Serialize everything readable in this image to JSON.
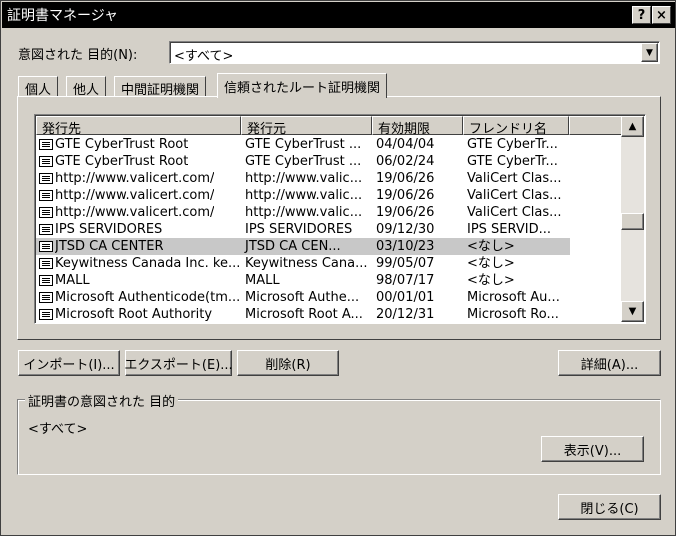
{
  "window": {
    "title": "証明書マネージャ",
    "help_btn": "?",
    "close_btn": "×"
  },
  "purpose": {
    "label": "意図された 目的(N):",
    "value": "<すべて>"
  },
  "tabs": [
    {
      "label": "個人",
      "active": false
    },
    {
      "label": "他人",
      "active": false
    },
    {
      "label": "中間証明機関",
      "active": false
    },
    {
      "label": "信頼されたルート証明機関",
      "active": true
    }
  ],
  "table": {
    "columns": [
      "発行先",
      "発行元",
      "有効期限",
      "フレンドリ名"
    ],
    "rows": [
      {
        "issued_to": "GTE CyberTrust Root",
        "issued_by": "GTE CyberTrust ...",
        "expires": "04/04/04",
        "friendly": "GTE CyberTr..."
      },
      {
        "issued_to": "GTE CyberTrust Root",
        "issued_by": "GTE CyberTrust ...",
        "expires": "06/02/24",
        "friendly": "GTE CyberTr..."
      },
      {
        "issued_to": "http://www.valicert.com/",
        "issued_by": "http://www.valic...",
        "expires": "19/06/26",
        "friendly": "ValiCert Clas..."
      },
      {
        "issued_to": "http://www.valicert.com/",
        "issued_by": "http://www.valic...",
        "expires": "19/06/26",
        "friendly": "ValiCert Clas..."
      },
      {
        "issued_to": "http://www.valicert.com/",
        "issued_by": "http://www.valic...",
        "expires": "19/06/26",
        "friendly": "ValiCert Clas..."
      },
      {
        "issued_to": "IPS SERVIDORES",
        "issued_by": "IPS SERVIDORES",
        "expires": "09/12/30",
        "friendly": "IPS SERVID..."
      },
      {
        "issued_to": "JTSD CA CENTER",
        "issued_by": "JTSD CA CEN...",
        "expires": "03/10/23",
        "friendly": "<なし>",
        "selected": true
      },
      {
        "issued_to": "Keywitness Canada Inc. ke...",
        "issued_by": "Keywitness Cana...",
        "expires": "99/05/07",
        "friendly": "<なし>"
      },
      {
        "issued_to": "MALL",
        "issued_by": "MALL",
        "expires": "98/07/17",
        "friendly": "<なし>"
      },
      {
        "issued_to": "Microsoft Authenticode(tm...",
        "issued_by": "Microsoft Authe...",
        "expires": "00/01/01",
        "friendly": "Microsoft Au..."
      },
      {
        "issued_to": "Microsoft Root Authority",
        "issued_by": "Microsoft Root A...",
        "expires": "20/12/31",
        "friendly": "Microsoft Ro..."
      }
    ]
  },
  "scrollbar": {
    "up": "▲",
    "down": "▼",
    "thumb_position": 0.52
  },
  "buttons": {
    "import": "インポート(I)...",
    "export": "エクスポート(E)...",
    "remove": "削除(R)",
    "detail": "詳細(A)...",
    "view": "表示(V)...",
    "close": "閉じる(C)"
  },
  "group": {
    "title": "証明書の意図された 目的",
    "value": "<すべて>"
  }
}
